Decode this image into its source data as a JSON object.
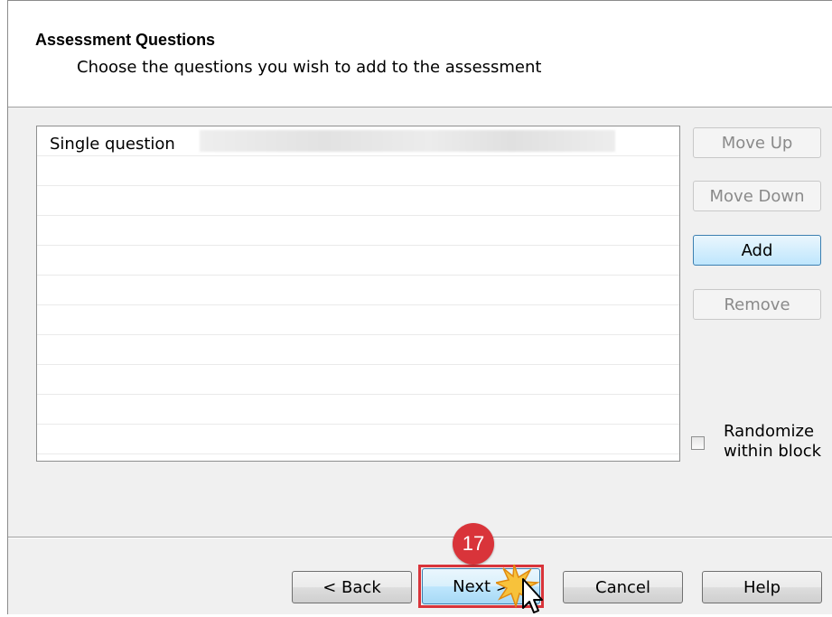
{
  "header": {
    "title": "Assessment Questions",
    "subtitle": "Choose the questions you wish to add to the assessment"
  },
  "questions": {
    "items": [
      {
        "label": "Single question"
      }
    ],
    "empty_rows": 10
  },
  "side_buttons": {
    "move_up": "Move Up",
    "move_down": "Move Down",
    "add": "Add",
    "remove": "Remove"
  },
  "randomize": {
    "label_line1": "Randomize",
    "label_line2": "within block",
    "checked": false
  },
  "footer": {
    "back": "< Back",
    "next": "Next >",
    "cancel": "Cancel",
    "help": "Help"
  },
  "annotation": {
    "step": "17",
    "highlight_color": "#d9343a",
    "icons": [
      "mouse-pointer-icon",
      "click-burst-icon"
    ]
  }
}
